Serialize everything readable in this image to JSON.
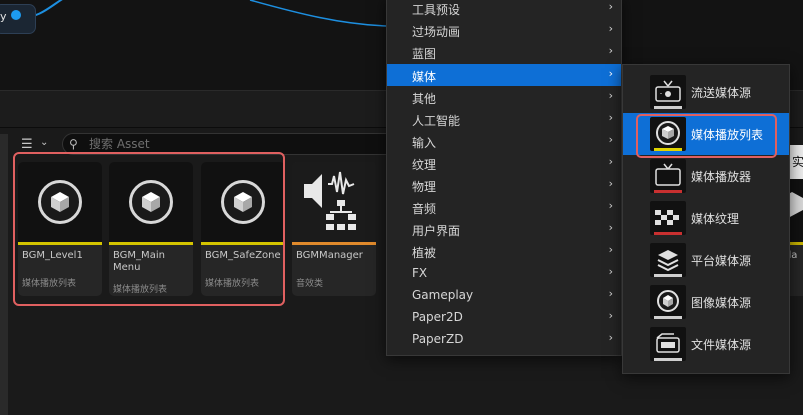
{
  "graph": {
    "node_label": "y"
  },
  "browser": {
    "search_placeholder": "搜索 Asset",
    "assets": [
      {
        "name": "BGM_Level1",
        "type": "媒体播放列表",
        "bar": "#d4c400"
      },
      {
        "name": "BGM_Main Menu",
        "type": "媒体播放列表",
        "bar": "#d4c400"
      },
      {
        "name": "BGM_SafeZone",
        "type": "媒体播放列表",
        "bar": "#d4c400"
      },
      {
        "name": "BGMManager",
        "type": "音效类",
        "bar": "#e08a2c"
      }
    ],
    "partial_asset_name": "bola",
    "tooltip_partial": "实"
  },
  "menu": {
    "items": [
      {
        "label": "工具预设"
      },
      {
        "label": "过场动画"
      },
      {
        "label": "蓝图"
      },
      {
        "label": "媒体"
      },
      {
        "label": "其他"
      },
      {
        "label": "人工智能"
      },
      {
        "label": "输入"
      },
      {
        "label": "纹理"
      },
      {
        "label": "物理"
      },
      {
        "label": "音频"
      },
      {
        "label": "用户界面"
      },
      {
        "label": "植被"
      },
      {
        "label": "FX"
      },
      {
        "label": "Gameplay"
      },
      {
        "label": "Paper2D"
      },
      {
        "label": "PaperZD"
      }
    ],
    "arrow": "›"
  },
  "submenu": {
    "items": [
      {
        "label": "流送媒体源",
        "icon": "stream-media-source-icon",
        "strip": "#cfcfcf"
      },
      {
        "label": "媒体播放列表",
        "icon": "media-playlist-icon",
        "strip": "#e0d400"
      },
      {
        "label": "媒体播放器",
        "icon": "media-player-icon",
        "strip": "#c83030"
      },
      {
        "label": "媒体纹理",
        "icon": "media-texture-icon",
        "strip": "#c83030"
      },
      {
        "label": "平台媒体源",
        "icon": "platform-media-source-icon",
        "strip": "#cfcfcf"
      },
      {
        "label": "图像媒体源",
        "icon": "image-media-source-icon",
        "strip": "#cfcfcf"
      },
      {
        "label": "文件媒体源",
        "icon": "file-media-source-icon",
        "strip": "#cfcfcf"
      }
    ]
  },
  "colors": {
    "accent": "#0e6fd6",
    "highlight": "#e06060",
    "playlist_bar": "#d4c400",
    "sound_class_bar": "#e08a2c"
  }
}
